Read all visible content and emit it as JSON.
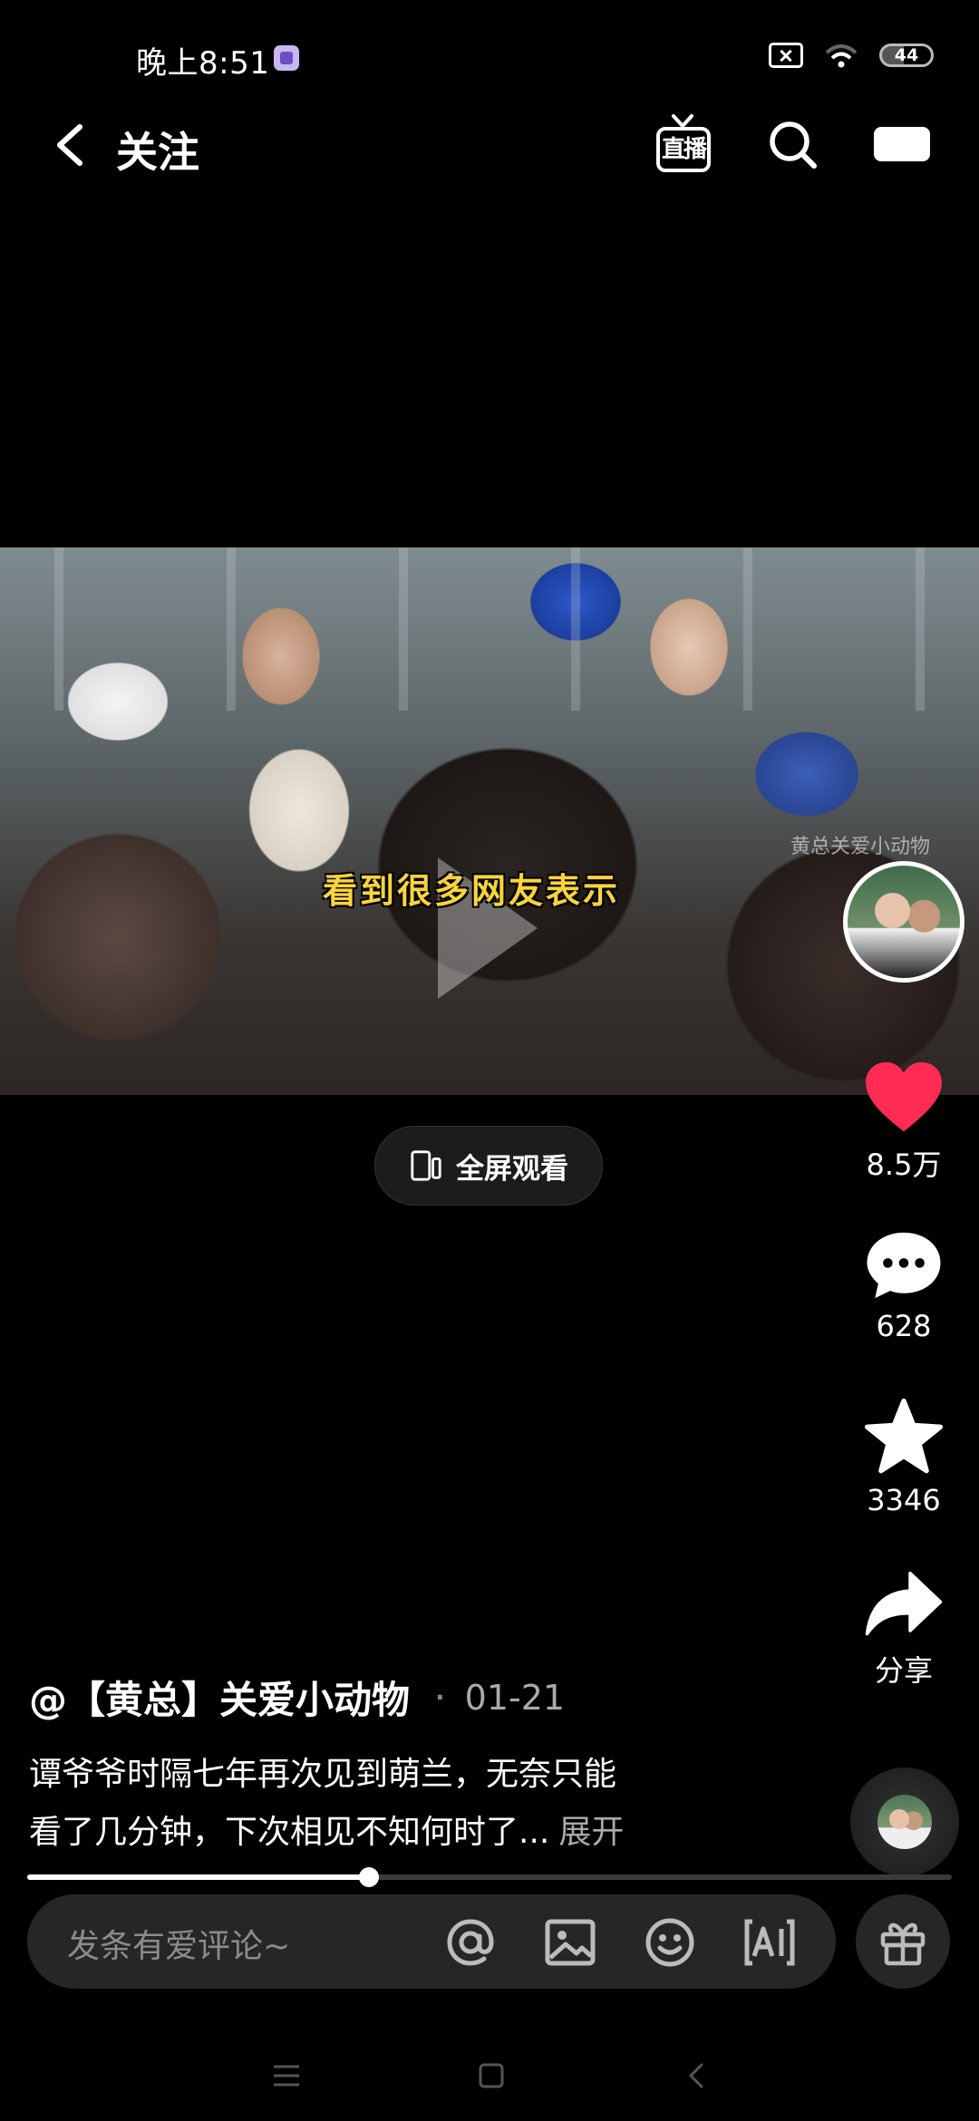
{
  "status_bar": {
    "time": "晚上8:51",
    "battery": "44"
  },
  "nav": {
    "title": "关注",
    "live_label": "直播"
  },
  "video": {
    "subtitle": "看到很多网友表示",
    "watermark": "黄总关爱小动物",
    "fullscreen_label": "全屏观看",
    "progress_percent": 37
  },
  "actions": {
    "likes": "8.5万",
    "comments": "628",
    "favorites": "3346",
    "share": "分享",
    "like_color": "#fe2c55"
  },
  "post": {
    "author": "@【黄总】关爱小动物",
    "date": "01-21",
    "caption_line1": "谭爷爷时隔七年再次见到萌兰，无奈只能",
    "caption_line2": "看了几分钟，下次相见不知何时了...",
    "expand": "展开"
  },
  "comment_bar": {
    "placeholder": "发条有爱评论~"
  }
}
